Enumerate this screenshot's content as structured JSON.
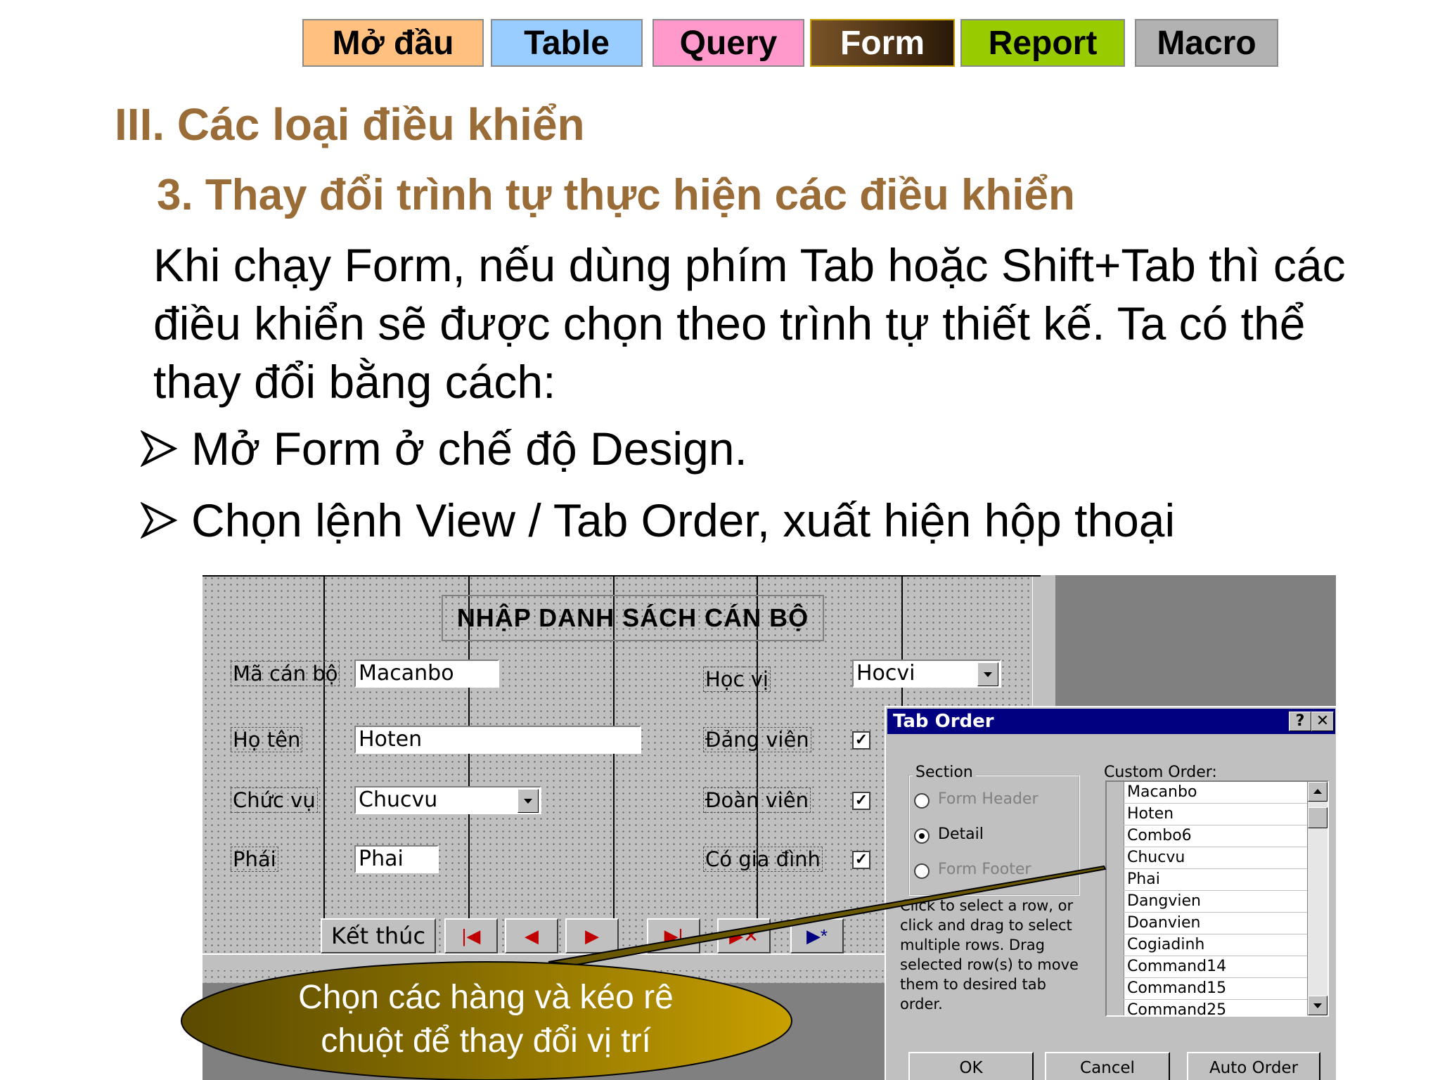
{
  "nav": {
    "tabs": [
      {
        "label": "Mở đầu",
        "color": "#ffc080"
      },
      {
        "label": "Table",
        "color": "#99ccff"
      },
      {
        "label": "Query",
        "color": "#ff99cc"
      },
      {
        "label": "Form",
        "color": "#5a3a1a"
      },
      {
        "label": "Report",
        "color": "#99cc00"
      },
      {
        "label": "Macro",
        "color": "#b2b2b2"
      }
    ]
  },
  "heading": "III. Các loại điều khiển",
  "subheading": "3. Thay đổi trình tự thực hiện các điều khiển",
  "paragraph": {
    "line1": " Khi chạy Form, nếu dùng phím Tab hoặc Shift+Tab thì các",
    "line2": "điều khiển sẽ được chọn theo trình tự thiết kế. Ta có thể",
    "line3": "thay đổi bằng cách:"
  },
  "bullets": [
    "Mở Form ở chế độ Design.",
    "Chọn lệnh View / Tab Order, xuất hiện hộp thoại"
  ],
  "form": {
    "title": "NHẬP DANH SÁCH CÁN BỘ",
    "fields": {
      "macanbo_label": "Mã cán bộ",
      "macanbo_value": "Macanbo",
      "hoten_label": "Họ tên",
      "hoten_value": "Hoten",
      "chucvu_label": "Chức vụ",
      "chucvu_value": "Chucvu",
      "phai_label": "Phái",
      "phai_value": "Phai",
      "hocvi_label": "Học vị",
      "hocvi_value": "Hocvi",
      "dangvien_label": "Đảng viên",
      "doanvien_label": "Đoàn viên",
      "cogiadinh_label": "Có gia đình"
    },
    "checkmark": "✓",
    "buttons": {
      "ketthuc": "Kết thúc",
      "first": "|◀",
      "prev": "◀",
      "next": "▶",
      "last": "▶|",
      "delete": "▶✕",
      "new": "▶*"
    }
  },
  "dialog": {
    "title": "Tab Order",
    "help_btn": "?",
    "close_btn": "✕",
    "section_label": "Section",
    "sections": [
      "Form Header",
      "Detail",
      "Form Footer"
    ],
    "selected_section": "Detail",
    "help_text": "Click to select a row, or click and drag to select multiple rows. Drag selected row(s) to move them to desired tab order.",
    "custom_order_label": "Custom Order:",
    "custom_order": [
      "Macanbo",
      "Hoten",
      "Combo6",
      "Chucvu",
      "Phai",
      "Dangvien",
      "Doanvien",
      "Cogiadinh",
      "Command14",
      "Command15",
      "Command25"
    ],
    "ok": "OK",
    "cancel": "Cancel",
    "auto_order": "Auto Order"
  },
  "callout": {
    "line1": "Chọn các hàng và kéo rê",
    "line2": "chuột để thay đổi vị trí"
  }
}
